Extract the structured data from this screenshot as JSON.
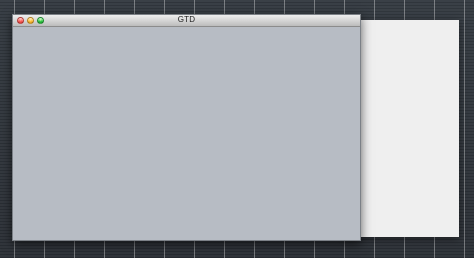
{
  "window": {
    "title": "GTD"
  },
  "icons": {
    "close": "close-traffic-light-icon",
    "minimize": "minimize-traffic-light-icon",
    "zoom": "zoom-traffic-light-icon"
  },
  "colors": {
    "desktop": "#2d3238",
    "window_body": "#b7bcc4",
    "side_panel": "#efefef",
    "close": "#ff5f57",
    "minimize": "#ffbd2e",
    "zoom": "#29c940"
  }
}
